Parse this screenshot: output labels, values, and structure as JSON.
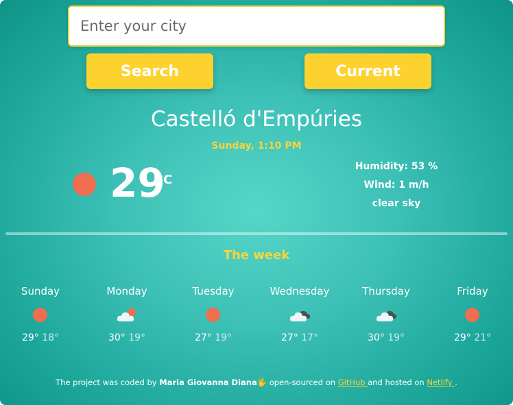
{
  "search": {
    "placeholder": "Enter your city",
    "value": "",
    "search_label": "Search",
    "current_label": "Current"
  },
  "current": {
    "city": "Castelló d'Empúries",
    "datetime": "Sunday, 1:10 PM",
    "temperature": "29",
    "unit": "°C",
    "humidity_text": "Humidity: 53 %",
    "wind_text": "Wind: 1 m/h",
    "description": "clear sky",
    "icon": "sun-icon"
  },
  "week": {
    "title": "The week",
    "days": [
      {
        "name": "Sunday",
        "icon": "sun-icon",
        "max": "29°",
        "min": "18°"
      },
      {
        "name": "Monday",
        "icon": "sun-behind-cloud-icon",
        "max": "30°",
        "min": "19°"
      },
      {
        "name": "Tuesday",
        "icon": "sun-icon",
        "max": "27°",
        "min": "19°"
      },
      {
        "name": "Wednesday",
        "icon": "cloud-icon",
        "max": "27°",
        "min": "17°"
      },
      {
        "name": "Thursday",
        "icon": "cloud-icon",
        "max": "30°",
        "min": "19°"
      },
      {
        "name": "Friday",
        "icon": "sun-icon",
        "max": "29°",
        "min": "21°"
      }
    ]
  },
  "footer": {
    "text_before": "The project was coded by ",
    "author": "Maria Giovanna Diana",
    "emoji": "🖖",
    "text_middle": " open-sourced on ",
    "github_label": "GitHub ",
    "text_hosted": " and hosted on ",
    "netlify_label": "Netlify ",
    "text_end": "."
  },
  "colors": {
    "accent": "#fdd22f",
    "date_yellow": "#f9d43c",
    "sun": "#ef6e50",
    "background_center": "#56d6c8",
    "background_edge": "#0e9487"
  }
}
